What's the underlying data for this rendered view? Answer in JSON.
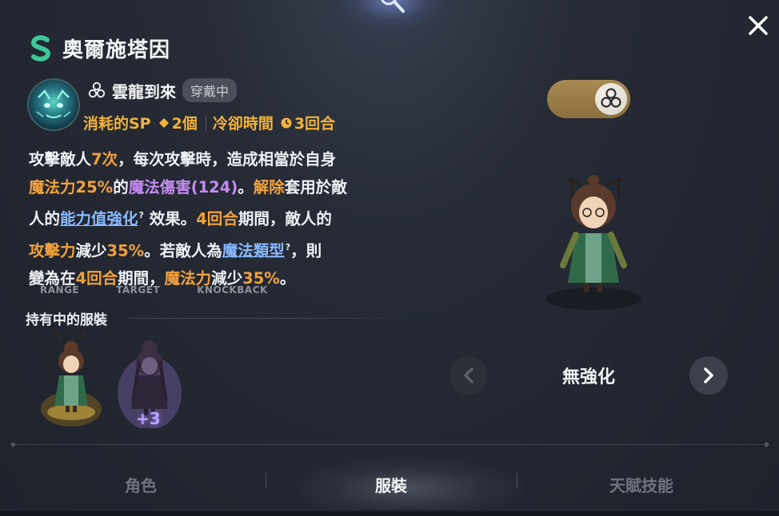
{
  "character": {
    "name": "奧爾施塔因",
    "icon": "serpent-s-icon"
  },
  "skill": {
    "name": "雲龍到來",
    "status_badge": "穿戴中",
    "sp_label": "消耗的SP",
    "sp_value": "2個",
    "cooldown_label": "冷卻時間",
    "cooldown_value": "3回合"
  },
  "description": {
    "l1a": "攻擊敵人",
    "l1b": "7次",
    "l1c": "，每次攻擊時，造成相當於自身",
    "l2a": "魔法力25%",
    "l2b": "的",
    "l2c": "魔法傷害(124)",
    "l2d": "。",
    "l2e": "解除",
    "l2f": "套用於敵",
    "l3a": "人的",
    "l3b": "能力值強化",
    "l3c": "效果。",
    "l3d": "4回合",
    "l3e": "期間，敵人的",
    "l4a": "攻擊力",
    "l4b": "減少",
    "l4c": "35%",
    "l4d": "。若敵人為",
    "l4e": "魔法類型",
    "l4f": "，則",
    "l5a": "變為在",
    "l5b": "4回合",
    "l5c": "期間，",
    "l5d": "魔法力",
    "l5e": "減少",
    "l5f": "35%",
    "l5g": "。"
  },
  "stats_header": {
    "range": "RANGE",
    "target": "TARGET",
    "knockback": "KNOCKBACK"
  },
  "owned_outfits": {
    "title": "持有中的服裝",
    "items": [
      {
        "name": "outfit-1"
      },
      {
        "name": "outfit-2",
        "badge": "+3"
      }
    ]
  },
  "preview": {
    "enhance_label": "無強化"
  },
  "tabs": [
    {
      "label": "角色",
      "active": false
    },
    {
      "label": "服裝",
      "active": true
    },
    {
      "label": "天賦技能",
      "active": false
    }
  ],
  "colors": {
    "orange_highlight": "#f2a23c",
    "purple_highlight": "#c58bf2",
    "link_blue": "#8ab8ff",
    "brand_green": "#3ec79a",
    "toggle_gold": "#a88a52"
  }
}
